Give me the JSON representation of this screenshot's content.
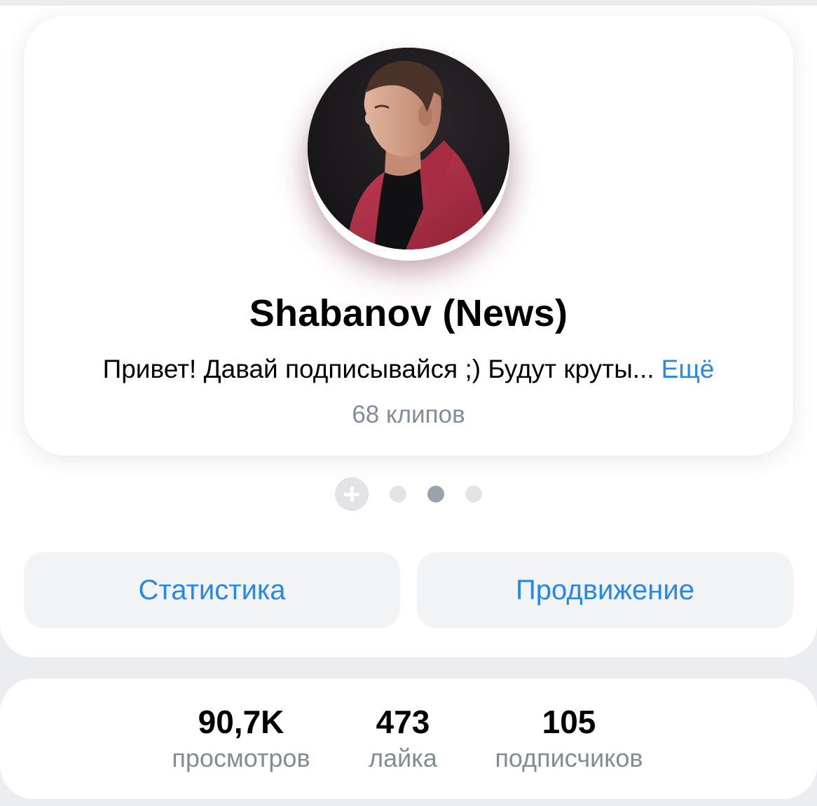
{
  "profile": {
    "name": "Shabanov (News)",
    "bio": "Привет! Давай подписывайся ;) Будут круты...",
    "bio_more": "Ещё",
    "clips_count": "68 клипов"
  },
  "pager": {
    "add_icon": "plus-icon",
    "dots": 3,
    "active_index": 1
  },
  "actions": {
    "statistics_label": "Статистика",
    "promotion_label": "Продвижение"
  },
  "stats": [
    {
      "value": "90,7K",
      "label": "просмотров"
    },
    {
      "value": "473",
      "label": "лайка"
    },
    {
      "value": "105",
      "label": "подписчиков"
    }
  ],
  "colors": {
    "accent": "#2688eb",
    "secondary_text": "#818c99",
    "button_bg": "#f2f3f5",
    "page_bg": "#ebedf0"
  }
}
